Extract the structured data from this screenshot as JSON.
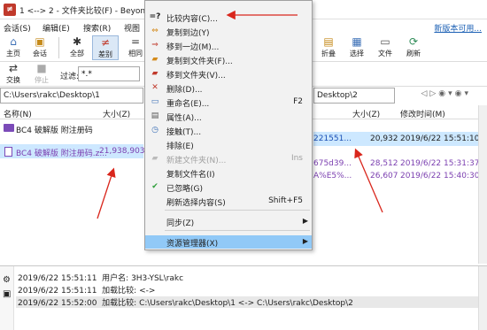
{
  "window": {
    "title": "1 <--> 2 - 文件夹比较(F) - Beyond Co"
  },
  "menubar": {
    "items": [
      "会话(S)",
      "编辑(E)",
      "搜索(R)",
      "视图"
    ],
    "promo_link": "新版本可用..."
  },
  "toolbar": {
    "buttons": [
      {
        "label": "主页",
        "icon": "home-icon"
      },
      {
        "label": "会话",
        "icon": "session-icon"
      },
      {
        "label": "全部",
        "icon": "all-icon"
      },
      {
        "label": "差别",
        "icon": "diff-icon"
      },
      {
        "label": "相同",
        "icon": "same-icon"
      }
    ],
    "right_buttons": [
      {
        "label": "折叠",
        "icon": "collapse-icon"
      },
      {
        "label": "选择",
        "icon": "select-icon"
      },
      {
        "label": "文件",
        "icon": "file-icon"
      },
      {
        "label": "刷新",
        "icon": "refresh-icon"
      }
    ]
  },
  "toolbar2": {
    "swap_label": "交换",
    "stop_label": "停止",
    "filter_label": "过滤:",
    "filter_value": "*.*"
  },
  "left_pane": {
    "path": "C:\\Users\\rakc\\Desktop\\1",
    "columns": {
      "name": "名称(N)",
      "size": "大小(Z)"
    },
    "rows": [
      {
        "name": "BC4 破解版 附注册码",
        "size": "",
        "type": "folder"
      },
      {
        "name": "BC4 破解版 附注册码.z...",
        "size": "21,938,903",
        "type": "file"
      }
    ]
  },
  "right_pane": {
    "path": "Desktop\\2",
    "columns": {
      "size": "大小(Z)",
      "modified": "修改时间(M)"
    },
    "rows": [
      {
        "name_frag": "221551...",
        "size": "20,932",
        "modified": "2019/6/22 15:51:10",
        "selected": true
      },
      {
        "name_frag": "675d39...",
        "size": "28,512",
        "modified": "2019/6/22 15:31:37",
        "selected": false
      },
      {
        "name_frag": "A%E5%...",
        "size": "26,607",
        "modified": "2019/6/22 15:40:30",
        "selected": false
      }
    ]
  },
  "context_menu": {
    "items": [
      {
        "label": "比较内容(C)...",
        "icon": "compare-icon",
        "shortcut": "",
        "disabled": false
      },
      {
        "label": "复制到边(Y)",
        "icon": "copy-to-side-icon",
        "shortcut": "",
        "disabled": false
      },
      {
        "label": "移到一边(M)...",
        "icon": "move-to-side-icon",
        "shortcut": "",
        "disabled": false
      },
      {
        "label": "复制到文件夹(F)...",
        "icon": "copy-to-folder-icon",
        "shortcut": "",
        "disabled": false
      },
      {
        "label": "移到文件夹(V)...",
        "icon": "move-to-folder-icon",
        "shortcut": "",
        "disabled": false
      },
      {
        "label": "删除(D)...",
        "icon": "delete-icon",
        "shortcut": "",
        "disabled": false
      },
      {
        "label": "重命名(E)...",
        "icon": "rename-icon",
        "shortcut": "F2",
        "disabled": false
      },
      {
        "label": "属性(A)...",
        "icon": "properties-icon",
        "shortcut": "",
        "disabled": false
      },
      {
        "label": "接触(T)...",
        "icon": "touch-icon",
        "shortcut": "",
        "disabled": false
      },
      {
        "label": "排除(E)",
        "icon": "exclude-icon",
        "shortcut": "",
        "disabled": false
      },
      {
        "label": "新建文件夹(N)...",
        "icon": "new-folder-icon",
        "shortcut": "Ins",
        "disabled": true
      },
      {
        "label": "复制文件名(I)",
        "icon": "",
        "shortcut": "",
        "disabled": false
      },
      {
        "label": "已忽略(G)",
        "icon": "check-icon",
        "shortcut": "",
        "disabled": false
      },
      {
        "label": "刷新选择内容(S)",
        "icon": "",
        "shortcut": "Shift+F5",
        "disabled": false
      },
      {
        "label": "同步(Z)",
        "icon": "",
        "shortcut": "",
        "disabled": false
      },
      {
        "label": "资源管理器(X)",
        "icon": "",
        "shortcut": "",
        "disabled": false
      }
    ]
  },
  "log": {
    "lines": [
      {
        "time": "2019/6/22 15:51:11",
        "text": "用户名: 3H3-YSL\\rakc"
      },
      {
        "time": "2019/6/22 15:51:11",
        "text": "加载比较: <->"
      },
      {
        "time": "2019/6/22 15:52:00",
        "text": "加载比较: C:\\Users\\rakc\\Desktop\\1 <-> C:\\Users\\rakc\\Desktop\\2"
      }
    ]
  },
  "colors": {
    "accent": "#91c9f7",
    "diff_purple": "#7b3fb0",
    "selection": "#cde8ff",
    "annotation_red": "#d9261c"
  }
}
